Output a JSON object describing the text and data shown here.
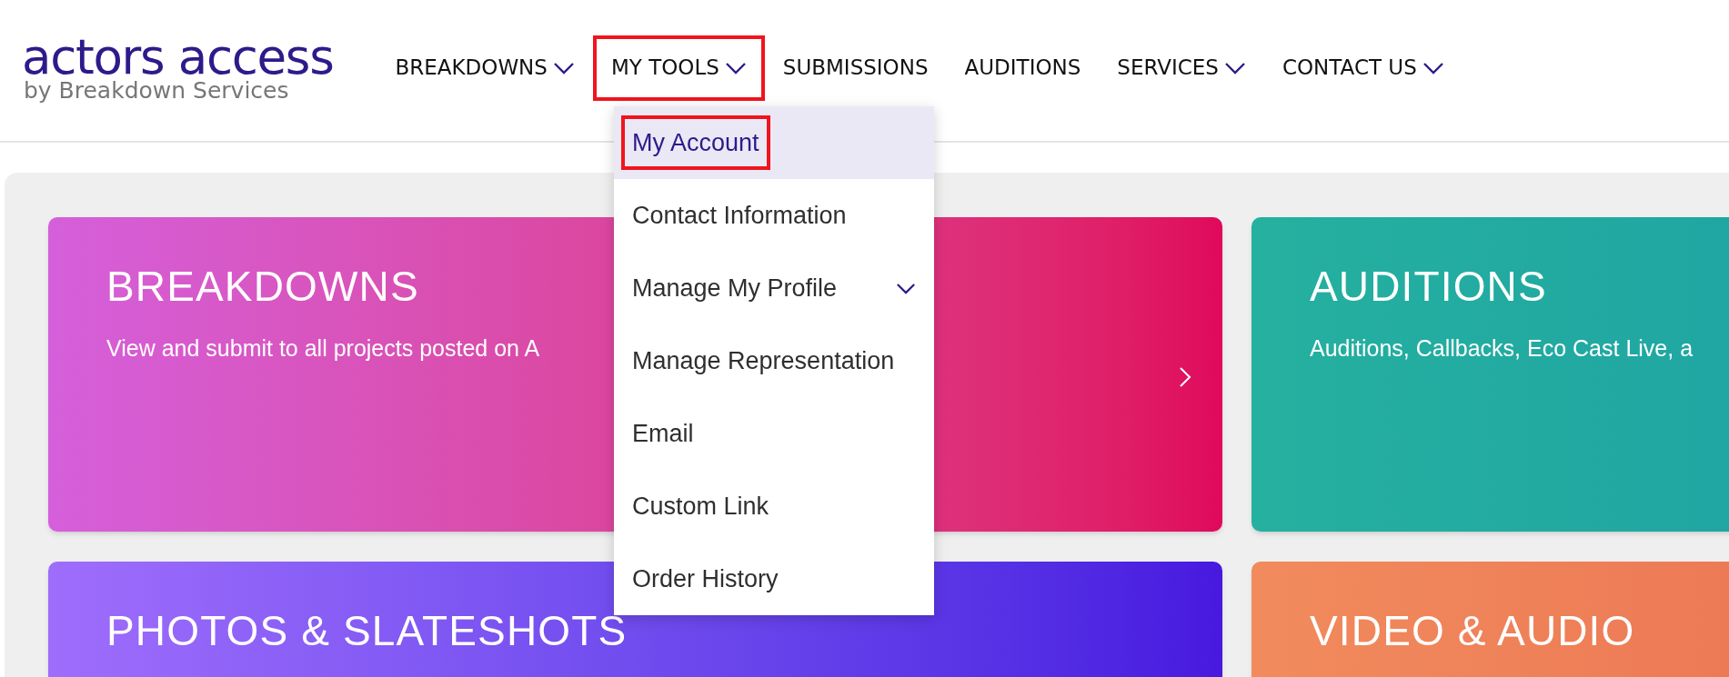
{
  "logo": {
    "name": "actors access",
    "tagline": "by Breakdown Services"
  },
  "nav": [
    {
      "label": "BREAKDOWNS",
      "dropdown": true,
      "annotated": false
    },
    {
      "label": "MY TOOLS",
      "dropdown": true,
      "annotated": true
    },
    {
      "label": "SUBMISSIONS",
      "dropdown": false,
      "annotated": false
    },
    {
      "label": "AUDITIONS",
      "dropdown": false,
      "annotated": false
    },
    {
      "label": "SERVICES",
      "dropdown": true,
      "annotated": false
    },
    {
      "label": "CONTACT US",
      "dropdown": true,
      "annotated": false
    }
  ],
  "menu": [
    {
      "label": "My Account",
      "kind": "link",
      "selected": true,
      "annotated": true
    },
    {
      "label": "Contact Information",
      "kind": "link",
      "selected": false,
      "annotated": false
    },
    {
      "label": "Manage My Profile",
      "kind": "submenu",
      "selected": false,
      "annotated": false
    },
    {
      "label": "Manage Representation",
      "kind": "link",
      "selected": false,
      "annotated": false
    },
    {
      "label": "Email",
      "kind": "link",
      "selected": false,
      "annotated": false
    },
    {
      "label": "Custom Link",
      "kind": "link",
      "selected": false,
      "annotated": false
    },
    {
      "label": "Order History",
      "kind": "link",
      "selected": false,
      "annotated": false
    }
  ],
  "cards": [
    {
      "title": "BREAKDOWNS",
      "subtitle": "View and submit to all projects posted on A",
      "arrow": true
    },
    {
      "title": "AUDITIONS",
      "subtitle": "Auditions, Callbacks, Eco Cast Live, a"
    },
    {
      "title": "PHOTOS & SLATESHOTS"
    },
    {
      "title": "VIDEO & AUDIO"
    }
  ]
}
